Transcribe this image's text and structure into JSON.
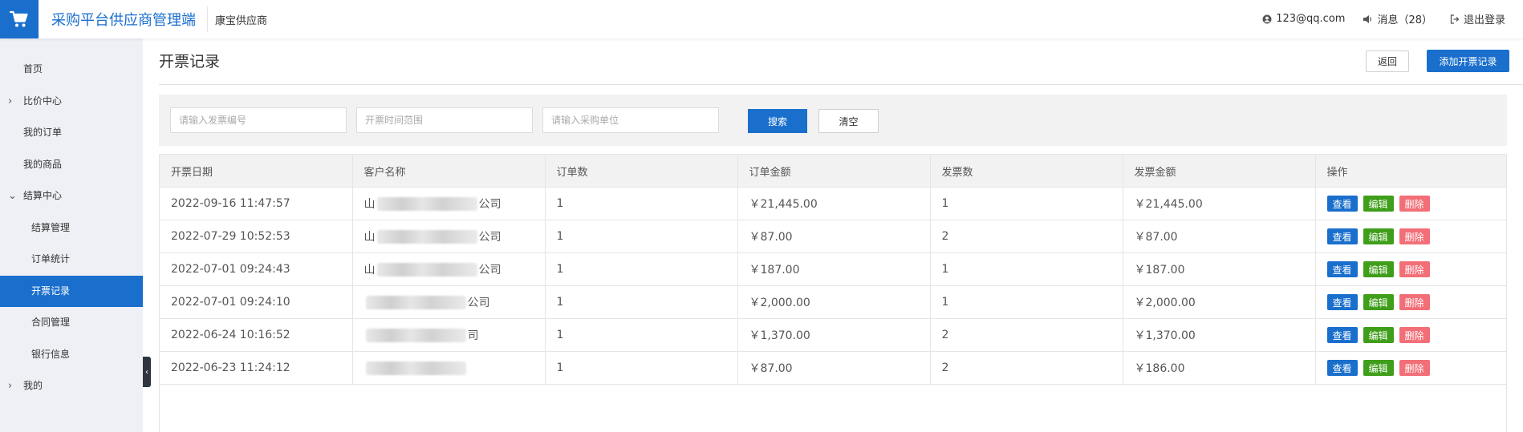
{
  "header": {
    "app_title": "采购平台供应商管理端",
    "supplier_name": "康宝供应商",
    "user_email": "123@qq.com",
    "messages_label": "消息（28）",
    "logout_label": "退出登录"
  },
  "sidebar": {
    "items": [
      {
        "label": "首页",
        "level": 0,
        "expandable": false,
        "active": false
      },
      {
        "label": "比价中心",
        "level": 0,
        "expandable": true,
        "active": false
      },
      {
        "label": "我的订单",
        "level": 0,
        "expandable": false,
        "active": false
      },
      {
        "label": "我的商品",
        "level": 0,
        "expandable": false,
        "active": false
      },
      {
        "label": "结算中心",
        "level": 0,
        "expandable": true,
        "expanded": true,
        "active": false
      },
      {
        "label": "结算管理",
        "level": 1,
        "expandable": false,
        "active": false
      },
      {
        "label": "订单统计",
        "level": 1,
        "expandable": false,
        "active": false
      },
      {
        "label": "开票记录",
        "level": 1,
        "expandable": false,
        "active": true
      },
      {
        "label": "合同管理",
        "level": 1,
        "expandable": false,
        "active": false
      },
      {
        "label": "银行信息",
        "level": 1,
        "expandable": false,
        "active": false
      },
      {
        "label": "我的",
        "level": 0,
        "expandable": true,
        "active": false
      }
    ]
  },
  "page": {
    "title": "开票记录",
    "back_label": "返回",
    "add_label": "添加开票记录"
  },
  "filters": {
    "invoice_no_placeholder": "请输入发票编号",
    "date_range_placeholder": "开票时间范围",
    "purchaser_placeholder": "请输入采购单位",
    "search_label": "搜索",
    "clear_label": "清空"
  },
  "table": {
    "columns": [
      "开票日期",
      "客户名称",
      "订单数",
      "订单金额",
      "发票数",
      "发票金额",
      "操作"
    ],
    "actions": {
      "view": "查看",
      "edit": "编辑",
      "delete": "删除"
    },
    "rows": [
      {
        "date": "2022-09-16 11:47:57",
        "customer_prefix": "山",
        "customer_suffix": "公司",
        "order_count": "1",
        "order_amount": "￥21,445.00",
        "invoice_count": "1",
        "invoice_amount": "￥21,445.00"
      },
      {
        "date": "2022-07-29 10:52:53",
        "customer_prefix": "山",
        "customer_suffix": "公司",
        "order_count": "1",
        "order_amount": "￥87.00",
        "invoice_count": "2",
        "invoice_amount": "￥87.00"
      },
      {
        "date": "2022-07-01 09:24:43",
        "customer_prefix": "山",
        "customer_suffix": "公司",
        "order_count": "1",
        "order_amount": "￥187.00",
        "invoice_count": "1",
        "invoice_amount": "￥187.00"
      },
      {
        "date": "2022-07-01 09:24:10",
        "customer_prefix": "",
        "customer_suffix": "公司",
        "order_count": "1",
        "order_amount": "￥2,000.00",
        "invoice_count": "1",
        "invoice_amount": "￥2,000.00"
      },
      {
        "date": "2022-06-24 10:16:52",
        "customer_prefix": "",
        "customer_suffix": "司",
        "order_count": "1",
        "order_amount": "￥1,370.00",
        "invoice_count": "2",
        "invoice_amount": "￥1,370.00"
      },
      {
        "date": "2022-06-23 11:24:12",
        "customer_prefix": "",
        "customer_suffix": "",
        "order_count": "1",
        "order_amount": "￥87.00",
        "invoice_count": "2",
        "invoice_amount": "￥186.00"
      }
    ]
  },
  "colors": {
    "primary": "#1a6fcd",
    "edit_green": "#3f9e1a",
    "delete_red": "#f26f77",
    "sidebar_bg": "#eef0f5"
  },
  "icons": {
    "logo": "shopping-cart-icon",
    "user": "user-icon",
    "messages": "speaker-icon",
    "logout": "logout-icon",
    "collapse": "chevron-left-icon"
  }
}
